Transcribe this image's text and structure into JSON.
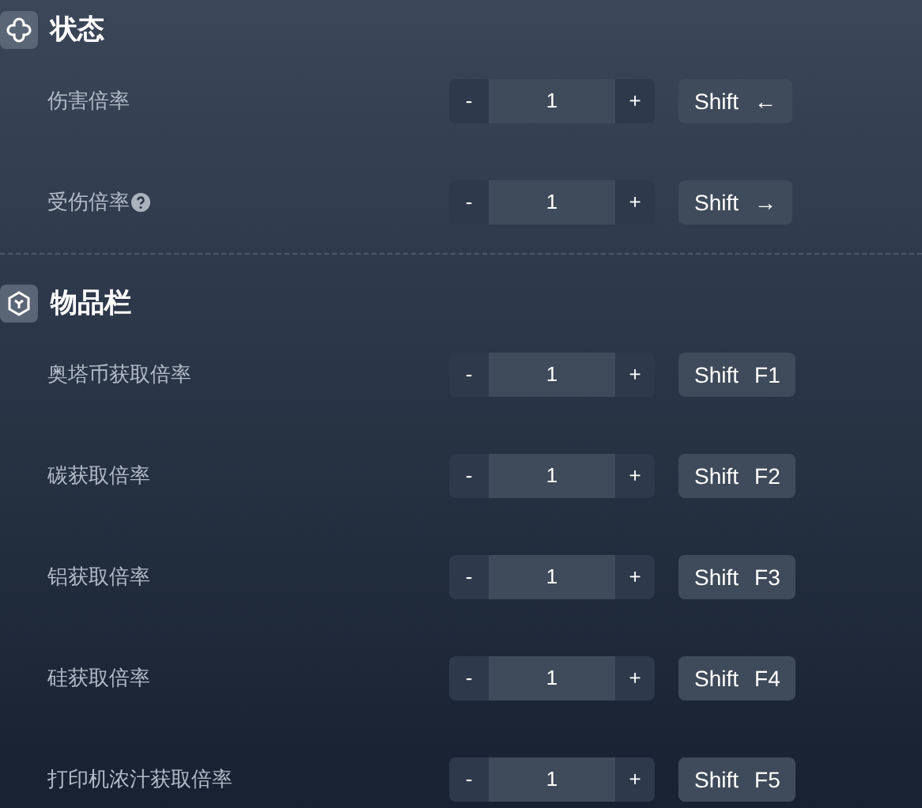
{
  "sections": [
    {
      "title": "状态",
      "kind": "status",
      "rows": [
        {
          "label": "伤害倍率",
          "help": false,
          "minus": "-",
          "value": "1",
          "plus": "+",
          "keys": [
            "Shift",
            "←"
          ]
        },
        {
          "label": "受伤倍率",
          "help": true,
          "minus": "-",
          "value": "1",
          "plus": "+",
          "keys": [
            "Shift",
            "→"
          ]
        }
      ]
    },
    {
      "title": "物品栏",
      "kind": "inventory",
      "rows": [
        {
          "label": "奥塔币获取倍率",
          "help": false,
          "minus": "-",
          "value": "1",
          "plus": "+",
          "keys": [
            "Shift",
            "F1"
          ]
        },
        {
          "label": "碳获取倍率",
          "help": false,
          "minus": "-",
          "value": "1",
          "plus": "+",
          "keys": [
            "Shift",
            "F2"
          ]
        },
        {
          "label": "铝获取倍率",
          "help": false,
          "minus": "-",
          "value": "1",
          "plus": "+",
          "keys": [
            "Shift",
            "F3"
          ]
        },
        {
          "label": "硅获取倍率",
          "help": false,
          "minus": "-",
          "value": "1",
          "plus": "+",
          "keys": [
            "Shift",
            "F4"
          ]
        },
        {
          "label": "打印机浓汁获取倍率",
          "help": false,
          "minus": "-",
          "value": "1",
          "plus": "+",
          "keys": [
            "Shift",
            "F5"
          ]
        }
      ]
    }
  ]
}
